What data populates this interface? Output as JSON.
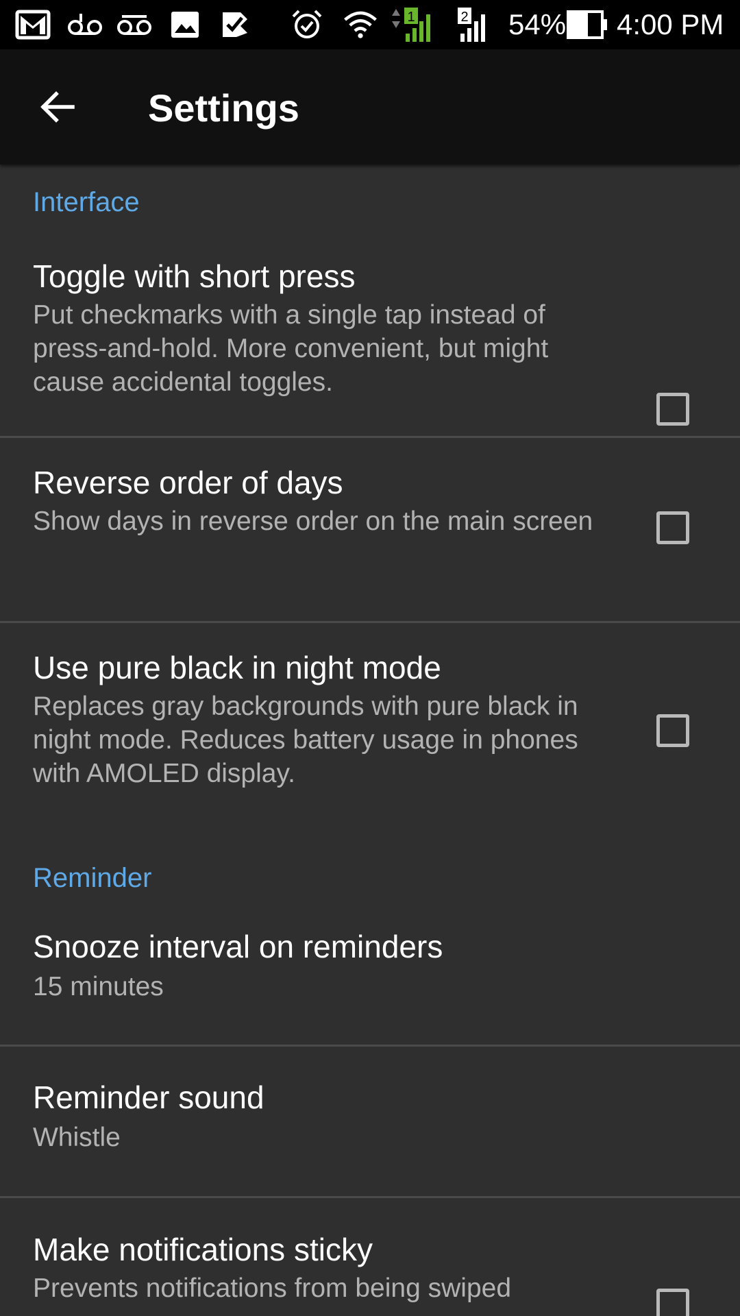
{
  "status_bar": {
    "icons": [
      "gmail-icon",
      "voicemail-icon",
      "voicemail-icon",
      "image-icon",
      "tasks-icon",
      "alarm-icon",
      "wifi-icon",
      "signal-sim1-icon",
      "signal-sim2-icon",
      "battery-icon"
    ],
    "sim1_badge": "1",
    "sim2_badge": "2",
    "battery_percent": "54%",
    "time": "4:00 PM"
  },
  "app_bar": {
    "title": "Settings",
    "back_icon": "arrow-left-icon"
  },
  "colors": {
    "background": "#2f2f30",
    "app_bar": "#111111",
    "accent": "#5ea9e6",
    "summary_text": "#b3b3b3"
  },
  "sections": [
    {
      "header": "Interface",
      "items": [
        {
          "title": "Toggle with short press",
          "summary": "Put checkmarks with a single tap instead of press-and-hold. More convenient, but might cause accidental toggles.",
          "checked": false
        },
        {
          "title": "Reverse order of days",
          "summary": "Show days in reverse order on the main screen",
          "checked": false
        },
        {
          "title": "Use pure black in night mode",
          "summary": "Replaces gray backgrounds with pure black in night mode. Reduces battery usage in phones with AMOLED display.",
          "checked": false
        }
      ]
    },
    {
      "header": "Reminder",
      "items": [
        {
          "title": "Snooze interval on reminders",
          "summary": "15 minutes"
        },
        {
          "title": "Reminder sound",
          "summary": "Whistle"
        },
        {
          "title": "Make notifications sticky",
          "summary": "Prevents notifications from being swiped",
          "checked": false
        }
      ]
    }
  ]
}
